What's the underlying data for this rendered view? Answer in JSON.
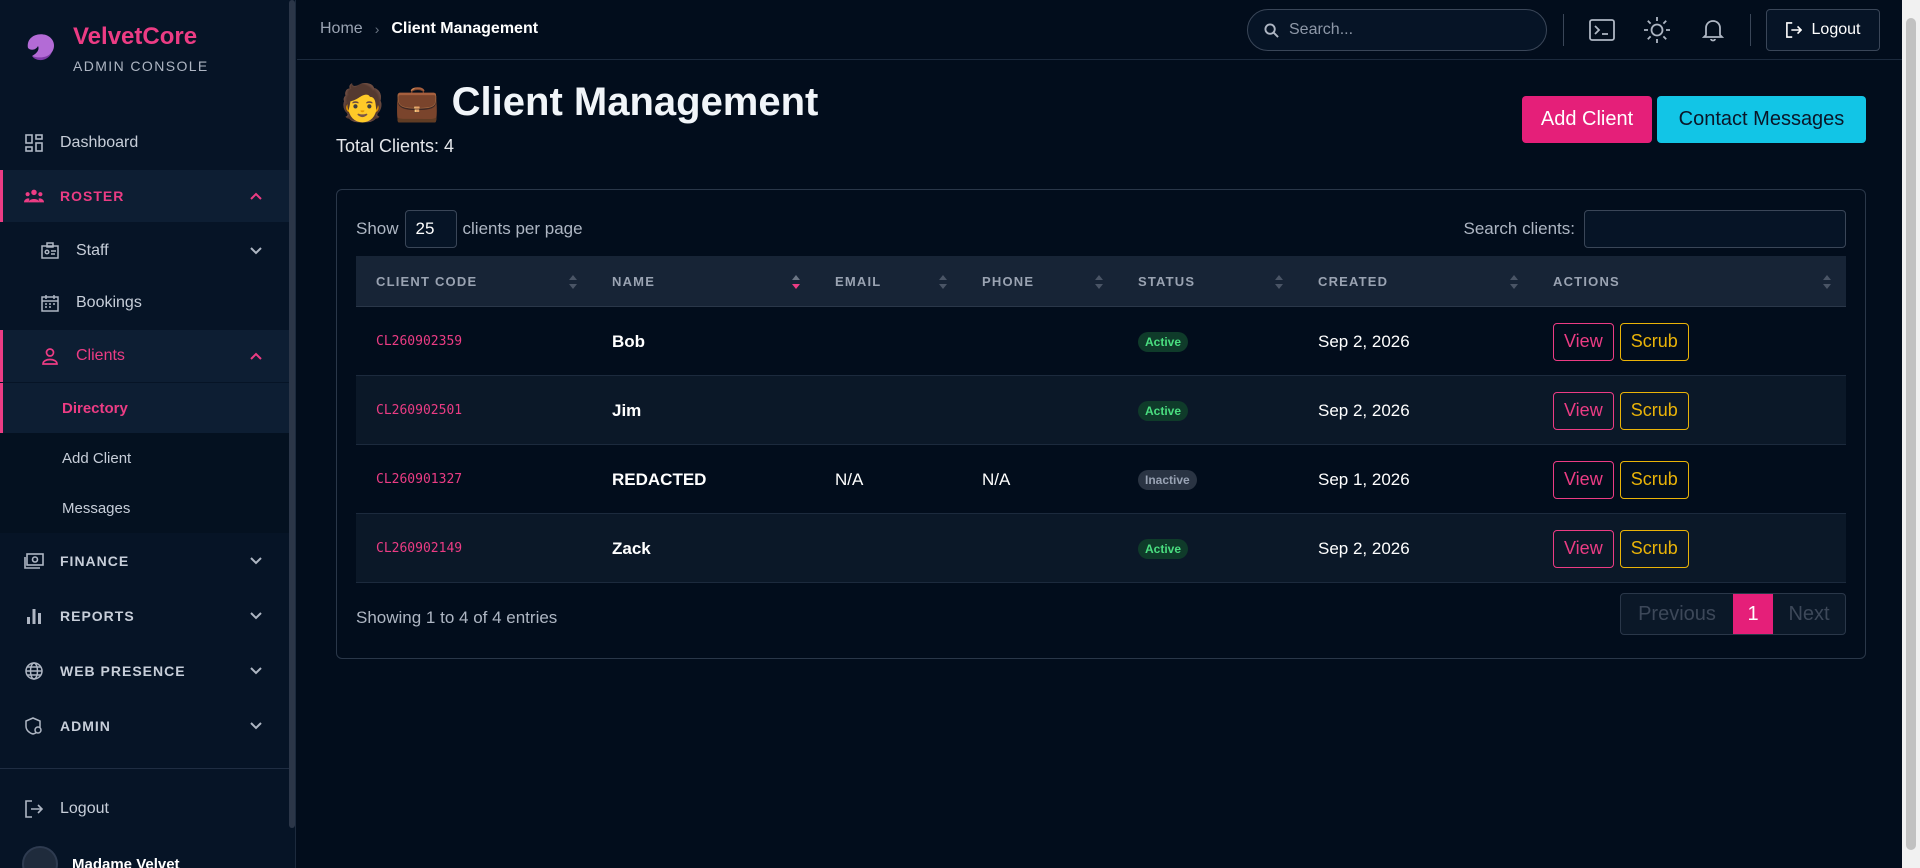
{
  "brand": {
    "name": "VelvetCore",
    "subtitle": "ADMIN CONSOLE"
  },
  "sidebar": {
    "dashboard": "Dashboard",
    "roster": "ROSTER",
    "staff": "Staff",
    "bookings": "Bookings",
    "clients": "Clients",
    "directory": "Directory",
    "add_client": "Add Client",
    "messages": "Messages",
    "finance": "FINANCE",
    "reports": "REPORTS",
    "web_presence": "WEB PRESENCE",
    "admin": "ADMIN",
    "logout": "Logout",
    "user_name": "Madame Velvet"
  },
  "topbar": {
    "breadcrumb_home": "Home",
    "breadcrumb_current": "Client Management",
    "search_placeholder": "Search...",
    "logout": "Logout"
  },
  "page": {
    "title_emoji": "🧑 💼",
    "title": "Client Management",
    "total": "Total Clients: 4",
    "add_client": "Add Client",
    "contact_messages": "Contact Messages"
  },
  "table": {
    "show_label": "Show",
    "per_page": "25",
    "per_page_suffix": "clients per page",
    "search_label": "Search clients:",
    "columns": [
      "CLIENT CODE",
      "NAME",
      "EMAIL",
      "PHONE",
      "STATUS",
      "CREATED",
      "ACTIONS"
    ],
    "rows": [
      {
        "code": "CL260902359",
        "name": "Bob",
        "email": "",
        "phone": "",
        "status": "Active",
        "created": "Sep 2, 2026"
      },
      {
        "code": "CL260902501",
        "name": "Jim",
        "email": "",
        "phone": "",
        "status": "Active",
        "created": "Sep 2, 2026"
      },
      {
        "code": "CL260901327",
        "name": "REDACTED",
        "email": "N/A",
        "phone": "N/A",
        "status": "Inactive",
        "created": "Sep 1, 2026"
      },
      {
        "code": "CL260902149",
        "name": "Zack",
        "email": "",
        "phone": "",
        "status": "Active",
        "created": "Sep 2, 2026"
      }
    ],
    "view_label": "View",
    "scrub_label": "Scrub",
    "showing": "Showing 1 to 4 of 4 entries",
    "pager": {
      "previous": "Previous",
      "page": "1",
      "next": "Next"
    }
  },
  "colors": {
    "accent": "#ec3c84",
    "cyan": "#12c5e6",
    "warning": "#eab308",
    "background": "#020d1c"
  }
}
